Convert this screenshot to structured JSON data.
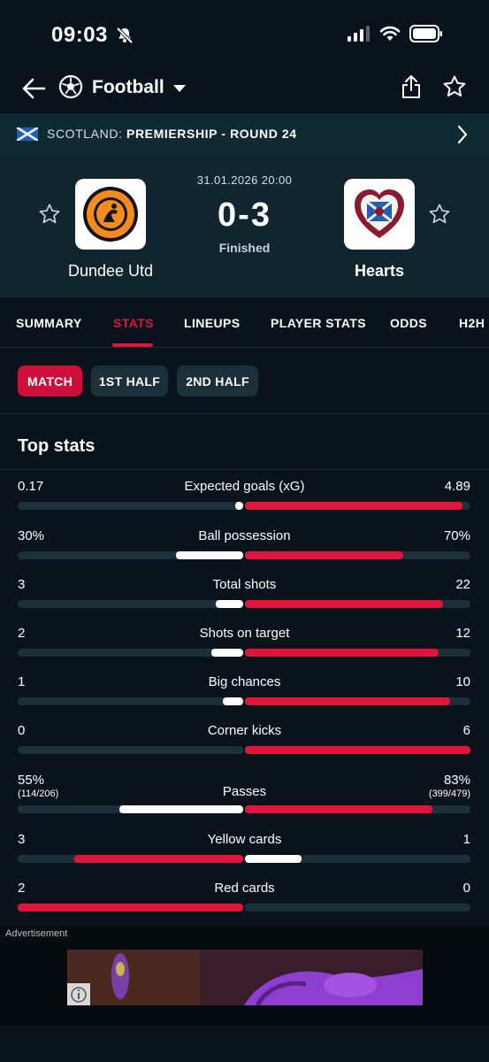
{
  "status_bar": {
    "time": "09:03"
  },
  "header": {
    "sport": "Football"
  },
  "league": {
    "country": "SCOTLAND:",
    "competition": "PREMIERSHIP - ROUND 24"
  },
  "match": {
    "datetime": "31.01.2026 20:00",
    "score": "0-3",
    "status": "Finished",
    "home": {
      "name": "Dundee Utd"
    },
    "away": {
      "name": "Hearts"
    }
  },
  "tabs": [
    "SUMMARY",
    "STATS",
    "LINEUPS",
    "PLAYER STATS",
    "ODDS",
    "H2H"
  ],
  "active_tab": "STATS",
  "periods": [
    "MATCH",
    "1ST HALF",
    "2ND HALF"
  ],
  "active_period": "MATCH",
  "section_title": "Top stats",
  "colors": {
    "accent": "#e1143c",
    "track": "#1b3038",
    "leading_home": "#e1143c",
    "trailing": "#ffffff"
  },
  "stats": [
    {
      "label": "Expected goals (xG)",
      "home": "0.17",
      "away": "4.89",
      "home_value": 0.17,
      "away_value": 4.89
    },
    {
      "label": "Ball possession",
      "home": "30%",
      "away": "70%",
      "home_value": 30,
      "away_value": 70
    },
    {
      "label": "Total shots",
      "home": "3",
      "away": "22",
      "home_value": 3,
      "away_value": 22
    },
    {
      "label": "Shots on target",
      "home": "2",
      "away": "12",
      "home_value": 2,
      "away_value": 12
    },
    {
      "label": "Big chances",
      "home": "1",
      "away": "10",
      "home_value": 1,
      "away_value": 10
    },
    {
      "label": "Corner kicks",
      "home": "0",
      "away": "6",
      "home_value": 0,
      "away_value": 6
    },
    {
      "label": "Passes",
      "home": "55%",
      "away": "83%",
      "home_sub": "(114/206)",
      "away_sub": "(399/479)",
      "home_value": 55,
      "away_value": 83
    },
    {
      "label": "Yellow cards",
      "home": "3",
      "away": "1",
      "home_value": 3,
      "away_value": 1
    },
    {
      "label": "Red cards",
      "home": "2",
      "away": "0",
      "home_value": 2,
      "away_value": 0
    }
  ],
  "ad": {
    "label": "Advertisement"
  }
}
